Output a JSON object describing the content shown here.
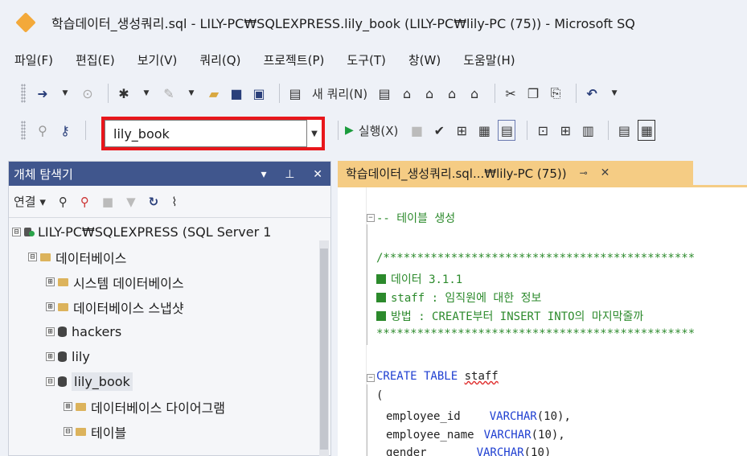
{
  "window": {
    "title": "학습데이터_생성쿼리.sql - LILY-PC₩SQLEXPRESS.lily_book (LILY-PC₩lily-PC (75)) - Microsoft SQ"
  },
  "menu": [
    "파일(F)",
    "편집(E)",
    "보기(V)",
    "쿼리(Q)",
    "프로젝트(P)",
    "도구(T)",
    "창(W)",
    "도움말(H)"
  ],
  "toolbar": {
    "new_query_label": "새 쿼리(N)",
    "execute_label": "실행(X)",
    "database_selected": "lily_book",
    "highlight_color": "#e8161b"
  },
  "object_explorer": {
    "title": "개체 탐색기",
    "connect_label": "연결",
    "tree": [
      {
        "label": "LILY-PC₩SQLEXPRESS (SQL Server 1",
        "expander": "⊟",
        "icon": "server",
        "indent": 0
      },
      {
        "label": "데이터베이스",
        "expander": "⊟",
        "icon": "folder",
        "indent": 1
      },
      {
        "label": "시스템 데이터베이스",
        "expander": "⊞",
        "icon": "folder",
        "indent": 2
      },
      {
        "label": "데이터베이스 스냅샷",
        "expander": "⊞",
        "icon": "folder",
        "indent": 2
      },
      {
        "label": "hackers",
        "expander": "⊞",
        "icon": "database",
        "indent": 2
      },
      {
        "label": "lily",
        "expander": "⊞",
        "icon": "database",
        "indent": 2
      },
      {
        "label": "lily_book",
        "expander": "⊟",
        "icon": "database",
        "indent": 2,
        "selected": true
      },
      {
        "label": "데이터베이스 다이어그램",
        "expander": "⊞",
        "icon": "folder",
        "indent": 3
      },
      {
        "label": "테이블",
        "expander": "⊟",
        "icon": "folder",
        "indent": 3
      }
    ]
  },
  "editor": {
    "tab_label": "학습데이터_생성쿼리.sql...₩lily-PC (75))",
    "lines": {
      "l1": "-- 테이블 생성",
      "l2": "/**********************************************",
      "l3": "데이터 3.1.1",
      "l4": "staff : 임직원에 대한 정보",
      "l5": "방법 : CREATE부터 INSERT INTO의 마지막줄까",
      "l6": "***********************************************",
      "l7_kw": "CREATE TABLE",
      "l7_name": "staff",
      "l8": "(",
      "col1_name": "employee_id",
      "col1_type": "VARCHAR",
      "col1_args": "(10),",
      "col2_name": "employee_name",
      "col2_type": "VARCHAR",
      "col2_args": "(10),",
      "col3_name": "gender",
      "col3_type": "VARCHAR",
      "col3_args": "(10)"
    }
  }
}
